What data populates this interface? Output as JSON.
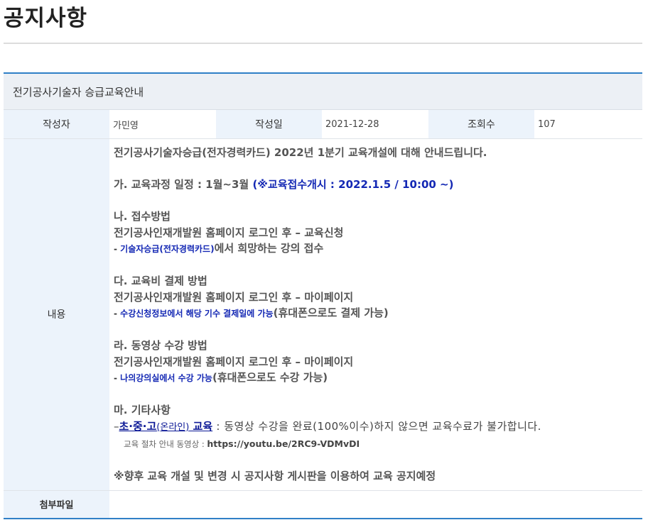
{
  "page": {
    "title": "공지사항"
  },
  "post": {
    "subject": "전기공사기술자 승급교육안내",
    "author_label": "작성자",
    "author": "가민영",
    "date_label": "작성일",
    "date": "2021-12-28",
    "views_label": "조회수",
    "views": "107",
    "content_label": "내용",
    "attachment_label": "첨부파일"
  },
  "content": {
    "intro": "전기공사기술자승급(전자경력카드) 2022년 1분기 교육개설에 대해 안내드립니다.",
    "s1_title": "가. 교육과정 일정 : 1월~3월 ",
    "s1_highlight": "(※교육접수개시 : 2022.1.5 / 10:00 ~)",
    "s2_title": "나. 접수방법",
    "s2_line1": "전기공사인재개발원 홈페이지 로그인 후 – 교육신청",
    "s2_dash": "- ",
    "s2_highlight": "기술자승급(전자경력카드)",
    "s2_rest": "에서 희망하는 강의 접수",
    "s3_title": "다. 교육비 결제 방법",
    "s3_line1": "전기공사인재개발원 홈페이지 로그인 후 – 마이페이지",
    "s3_dash": "- ",
    "s3_highlight": "수강신청정보에서 해당 기수 결제일에 가능",
    "s3_rest": "(휴대폰으로도 결제 가능)",
    "s4_title": "라. 동영상 수강 방법",
    "s4_line1": "전기공사인재개발원 홈페이지 로그인 후 – 마이페이지",
    "s4_dash": "- ",
    "s4_highlight": "나의강의실에서 수강 가능",
    "s4_rest": "(휴대폰으로도 수강 가능)",
    "s5_title": "마. 기타사항",
    "s5_dash": "–",
    "s5_link1": "초·중·고",
    "s5_link2": "(온라인)",
    "s5_link3": " 교육",
    "s5_rest": " : 동영상 수강을 완료(100%이수)하지 않으면 교육수료가 불가합니다.",
    "video_label": "교육 절차 안내 동영상 : ",
    "video_url": "https://youtu.be/2RC9-VDMvDI",
    "notice": "※향후 교육 개설 및 변경 시 공지사항 게시판을 이용하여 교육 공지예정"
  },
  "colors": {
    "accent": "#2f7fc6",
    "highlight": "#1428b4",
    "label_bg": "#ecf3fb"
  }
}
